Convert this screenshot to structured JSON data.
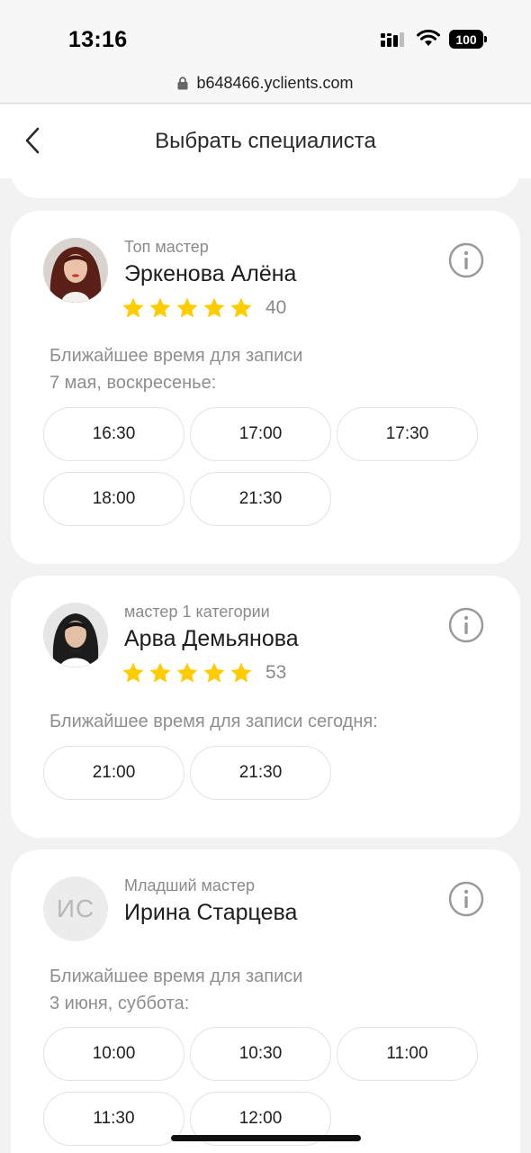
{
  "status_bar": {
    "time": "13:16",
    "battery": "100"
  },
  "browser": {
    "url": "b648466.yclients.com"
  },
  "header": {
    "title": "Выбрать специалиста"
  },
  "specialists": [
    {
      "role": "Топ мастер",
      "name": "Эркенова Алёна",
      "rating_stars": 5,
      "reviews": "40",
      "nearest_line1": "Ближайшее время для записи",
      "nearest_line2": "7 мая, воскресенье:",
      "slots": [
        "16:30",
        "17:00",
        "17:30",
        "18:00",
        "21:30"
      ]
    },
    {
      "role": "мастер 1 категории",
      "name": "Арва Демьянова",
      "rating_stars": 5,
      "reviews": "53",
      "nearest_line1": "Ближайшее время для записи сегодня:",
      "slots": [
        "21:00",
        "21:30"
      ]
    },
    {
      "role": "Младший мастер",
      "name": "Ирина Старцева",
      "avatar_initials": "ИС",
      "nearest_line1": "Ближайшее время для записи",
      "nearest_line2": "3 июня, суббота:",
      "slots": [
        "10:00",
        "10:30",
        "11:00",
        "11:30",
        "12:00"
      ]
    }
  ],
  "colors": {
    "star": "#ffcc00",
    "background": "#f2f2f2",
    "card": "#ffffff",
    "muted_text": "#8a8a8a",
    "info_icon": "#9a9a9a"
  },
  "icons": {
    "back": "chevron-left-icon",
    "info": "info-circle-icon",
    "star": "star-icon",
    "lock": "lock-icon",
    "signal": "cellular-signal-icon",
    "wifi": "wifi-icon",
    "battery": "battery-icon"
  }
}
